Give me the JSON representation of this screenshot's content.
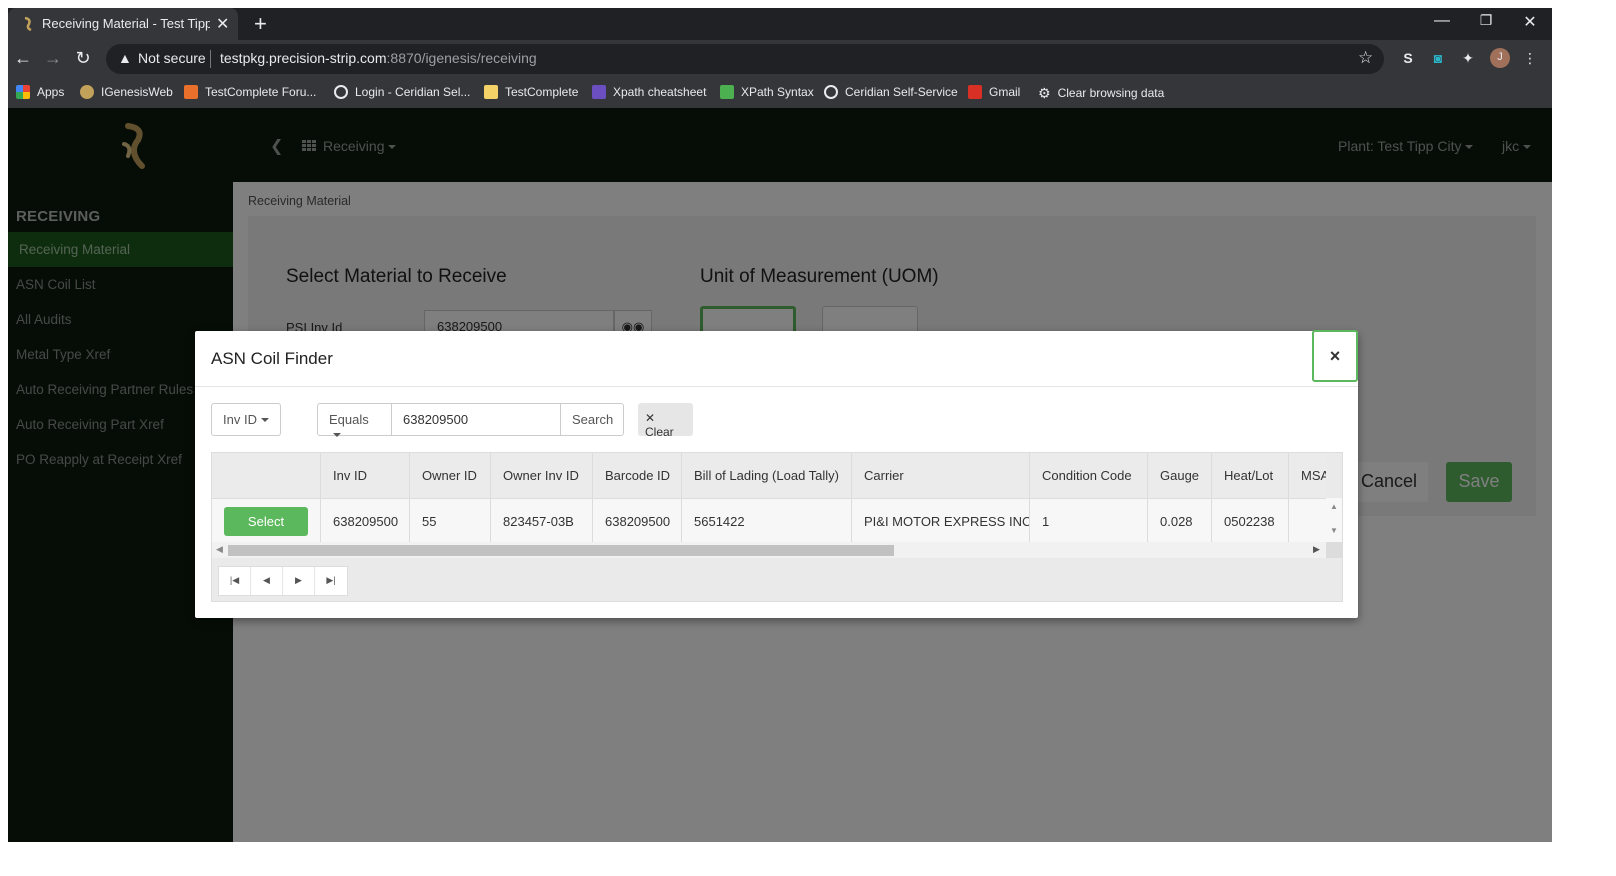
{
  "browser": {
    "tab_title": "Receiving Material - Test Tipp Cit",
    "new_tab": "+",
    "security_label": "Not secure",
    "url_host": "testpkg.precision-strip.com",
    "url_path": ":8870/igenesis/receiving",
    "window_controls": [
      "—",
      "❐",
      "✕"
    ],
    "bookmarks": [
      {
        "label": "Apps",
        "icon": "apps-grid-icon",
        "color": "#e8a838"
      },
      {
        "label": "IGenesisWeb",
        "icon": "igenesis-icon",
        "color": "#c2a15a"
      },
      {
        "label": "TestComplete Foru...",
        "icon": "testcomplete-icon",
        "color": "#e8702a"
      },
      {
        "label": "Login - Ceridian Sel...",
        "icon": "ceridian-icon",
        "color": "#e8eaed"
      },
      {
        "label": "TestComplete",
        "icon": "folder-icon",
        "color": "#f5d267"
      },
      {
        "label": "Xpath cheatsheet",
        "icon": "devhints-icon",
        "color": "#6b4fc1"
      },
      {
        "label": "XPath Syntax",
        "icon": "w3schools-icon",
        "color": "#4caf50"
      },
      {
        "label": "Ceridian Self-Service",
        "icon": "ceridian-icon",
        "color": "#e8eaed"
      },
      {
        "label": "Gmail",
        "icon": "gmail-icon",
        "color": "#d93025"
      },
      {
        "label": "Clear browsing data",
        "icon": "gear-icon",
        "color": "#e8eaed"
      }
    ],
    "profile_initial": "J"
  },
  "app": {
    "module_menu": "Receiving",
    "plant_menu": "Plant: Test Tipp City",
    "user_menu": "jkc",
    "sidebar": {
      "heading": "RECEIVING",
      "items": [
        {
          "label": "Receiving Material",
          "active": true
        },
        {
          "label": "ASN Coil List"
        },
        {
          "label": "All Audits"
        },
        {
          "label": "Metal Type Xref"
        },
        {
          "label": "Auto Receiving Partner Rules"
        },
        {
          "label": "Auto Receiving Part Xref"
        },
        {
          "label": "PO Reapply at Receipt Xref"
        }
      ]
    },
    "breadcrumb": "Receiving Material",
    "form": {
      "select_heading": "Select Material to Receive",
      "uom_heading": "Unit of Measurement (UOM)",
      "psi_inv_label": "PSI Inv Id",
      "psi_inv_value": "638209500",
      "cancel_label": "Cancel",
      "save_label": "Save"
    }
  },
  "modal": {
    "title": "ASN Coil Finder",
    "close": "×",
    "field_select": "Inv ID",
    "operator_select": "Equals",
    "search_value": "638209500",
    "search_label": "Search",
    "clear_label": "Clear",
    "columns": [
      "Inv ID",
      "Owner ID",
      "Owner Inv ID",
      "Barcode ID",
      "Bill of Lading (Load Tally)",
      "Carrier",
      "Condition Code",
      "Gauge",
      "Heat/Lot",
      "MSA"
    ],
    "rows": [
      {
        "select_label": "Select",
        "cells": [
          "638209500",
          "55",
          "823457-03B",
          "638209500",
          "5651422",
          "PI&I MOTOR EXPRESS INC",
          "1",
          "0.028",
          "0502238",
          ""
        ]
      }
    ],
    "pager": [
      "first-page-icon",
      "prev-page-icon",
      "next-page-icon",
      "last-page-icon"
    ]
  },
  "colors": {
    "nav_bg": "#0d1b0d",
    "active_item": "#1d5b1d",
    "accent_green": "#5cb85c"
  }
}
